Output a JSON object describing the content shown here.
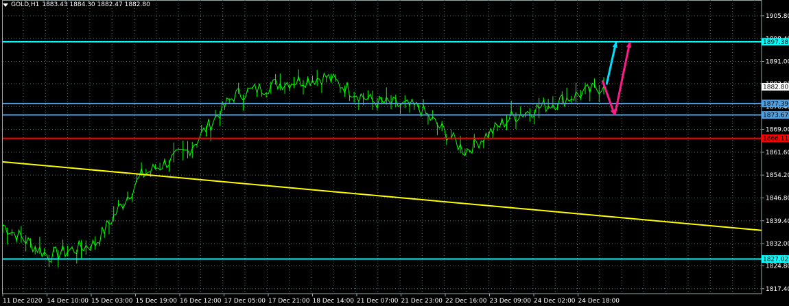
{
  "header": {
    "symbol": "GOLD,H1",
    "ohlc": "1883.43 1884.30 1882.47 1882.80"
  },
  "colors": {
    "background": "#000000",
    "candles": "#00ff00",
    "grid": "#5f6f6f",
    "axis_text": "#ffffff",
    "cyan_level": "#00ffff",
    "blue_level": "#4f9fe0",
    "red_level": "#ff0000",
    "trendline": "#ffff00",
    "arrow_up_cyan": "#00e0ff",
    "arrow_magenta": "#ff1a8c"
  },
  "price_axis": {
    "ticks": [
      "1905.80",
      "1898.40",
      "1891.00",
      "1883.80",
      "1876.40",
      "1869.00",
      "1861.60",
      "1854.20",
      "1846.80",
      "1839.40",
      "1832.00",
      "1824.80",
      "1817.40"
    ]
  },
  "time_axis": {
    "labels": [
      "11 Dec 2020",
      "14 Dec 10:00",
      "15 Dec 03:00",
      "15 Dec 19:00",
      "16 Dec 12:00",
      "17 Dec 05:00",
      "17 Dec 21:00",
      "18 Dec 14:00",
      "21 Dec 07:00",
      "21 Dec 23:00",
      "22 Dec 16:00",
      "23 Dec 09:00",
      "24 Dec 02:00",
      "24 Dec 18:00"
    ]
  },
  "levels": [
    {
      "price": 1897.38,
      "label": "1897.38",
      "color": "#00ffff"
    },
    {
      "price": 1877.39,
      "label": "1877.39",
      "color": "#4f9fe0"
    },
    {
      "price": 1873.67,
      "label": "1873.67",
      "color": "#4f9fe0"
    },
    {
      "price": 1866.11,
      "label": "1866.11",
      "color": "#ff0000"
    },
    {
      "price": 1827.02,
      "label": "1827.02",
      "color": "#00ffff"
    }
  ],
  "current_price": "1882.80",
  "chart_data": {
    "type": "line",
    "title": "GOLD,H1",
    "ylim": [
      1815.8,
      1910.9
    ],
    "x": [
      "11 Dec 2020",
      "14 Dec 10:00",
      "15 Dec 03:00",
      "15 Dec 19:00",
      "16 Dec 12:00",
      "17 Dec 05:00",
      "17 Dec 21:00",
      "18 Dec 14:00",
      "21 Dec 07:00",
      "21 Dec 23:00",
      "22 Dec 16:00",
      "23 Dec 09:00",
      "24 Dec 02:00",
      "24 Dec 18:00"
    ],
    "series": [
      {
        "values": [
          1838,
          1828,
          1832,
          1854,
          1862,
          1880,
          1884,
          1886,
          1878,
          1876,
          1862,
          1873,
          1878,
          1883
        ]
      }
    ],
    "trendline": {
      "start_price": 1858.5,
      "end_price": 1836.3
    }
  }
}
